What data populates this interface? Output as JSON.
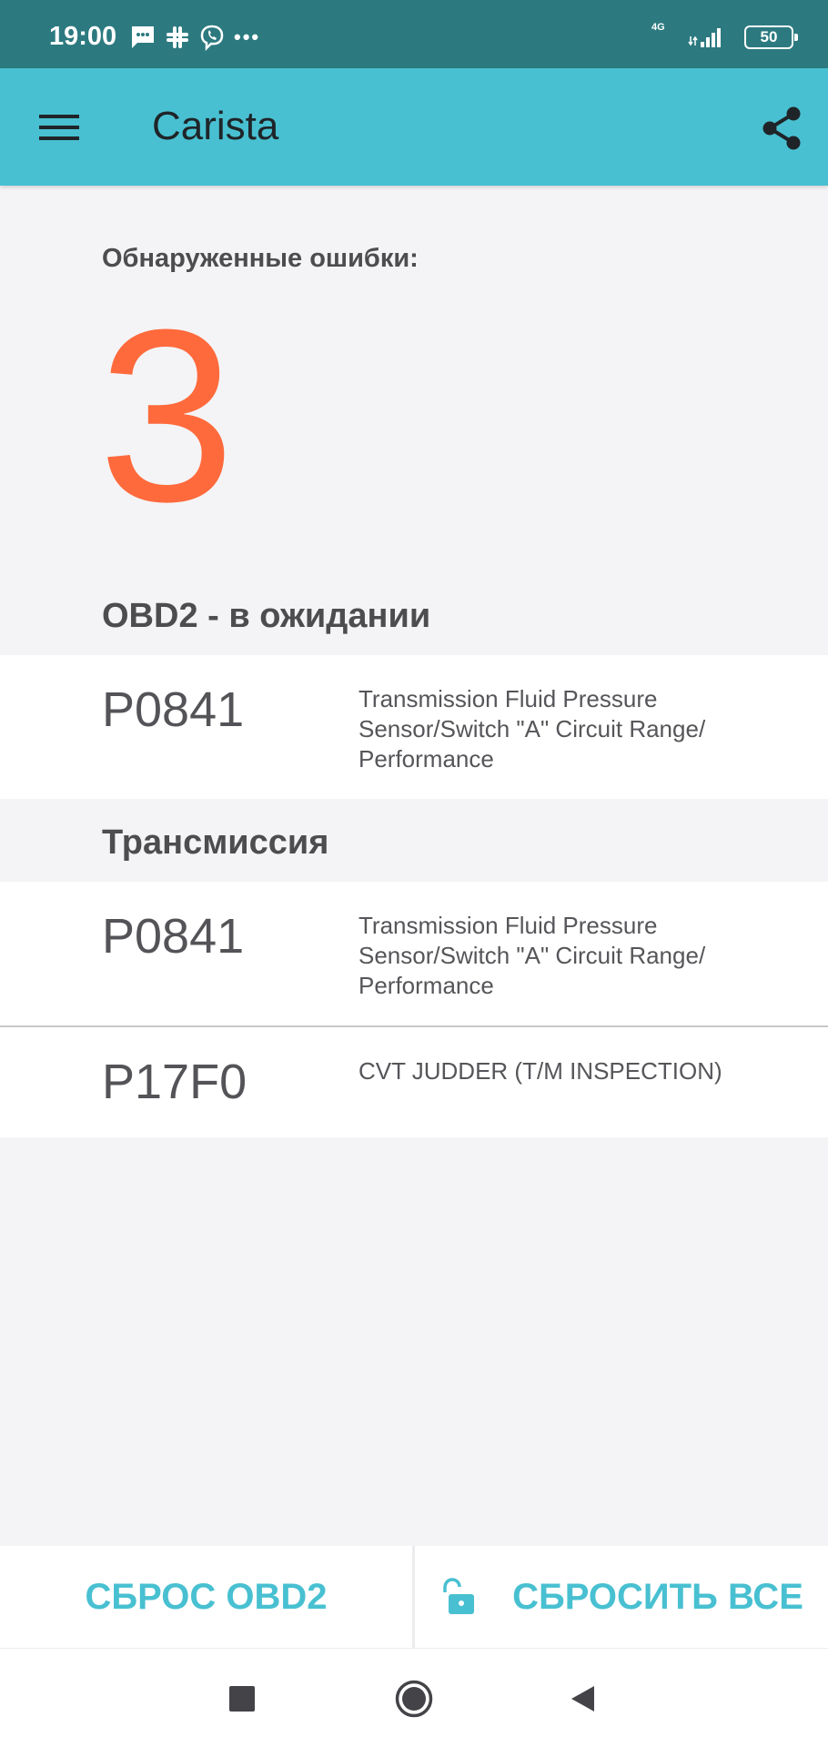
{
  "status_bar": {
    "time": "19:00",
    "network": "4G",
    "battery": "50",
    "more": "•••"
  },
  "app_bar": {
    "title": "Carista"
  },
  "summary": {
    "label": "Обнаруженные ошибки:",
    "count": "3"
  },
  "sections": [
    {
      "title": "OBD2 - в ожидании",
      "errors": [
        {
          "code": "P0841",
          "description": "Transmission Fluid Pressure Sensor/Switch \"A\" Circuit Range/ Performance"
        }
      ]
    },
    {
      "title": "Трансмиссия",
      "errors": [
        {
          "code": "P0841",
          "description": "Transmission Fluid Pressure Sensor/Switch \"A\" Circuit Range/ Performance"
        },
        {
          "code": "P17F0",
          "description": "CVT JUDDER (T/M INSPECTION)"
        }
      ]
    }
  ],
  "actions": {
    "reset_obd2": "СБРОС OBD2",
    "reset_all": "СБРОСИТЬ ВСЕ"
  },
  "colors": {
    "status_bar": "#2c7a80",
    "app_bar": "#48c0d1",
    "accent": "#48c0d1",
    "count": "#ff6a3c",
    "background": "#f4f4f6"
  }
}
